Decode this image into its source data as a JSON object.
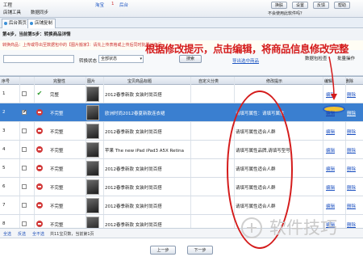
{
  "menubar": {
    "m1": "工程",
    "m2": "店铺工具",
    "m3": "数据同步",
    "title_a": "淘宝",
    "title_b": "1",
    "title_c": "后台",
    "btn1": "换肤",
    "btn2": "设置",
    "btn3": "反馈",
    "btn4": "帮助",
    "notice": "不会使用此软件吗？"
  },
  "tabs": [
    {
      "label": "后台首页"
    },
    {
      "label": "店铺复制"
    }
  ],
  "step": "第4步，当前第5步：转换商品详情",
  "links": {
    "l1": "转换商品：上传或导出至数据包中的【图片搬家】：请先上传表格或上传后同时批量对商品"
  },
  "filter": {
    "label": "转换状态",
    "select": "全部状态",
    "btn": "搜索",
    "right1": "导出选中商品",
    "right2": "数据包检查",
    "right3": "批量操作"
  },
  "annotation": "根据修改提示，点击编辑，将商品信息修改完整",
  "columns": {
    "num": "序号",
    "check": "",
    "state": "完整性",
    "img": "图片",
    "title": "宝贝商品标题",
    "cat": "自定义分类",
    "tip": "修改提示",
    "op1": "编辑",
    "op2": "删除"
  },
  "rows": [
    {
      "num": "1",
      "state": "完整",
      "title": "2012春季新款 女装时尚百搭",
      "tip": "",
      "edit": "编辑",
      "del": "删除",
      "ok": true,
      "checked": false
    },
    {
      "num": "2",
      "state": "不完整",
      "title": "欧洲时尚2012春夏新款连衣裙",
      "tip": "请填写属性：请填写属性",
      "edit": "编辑",
      "del": "删除",
      "ok": false,
      "checked": true
    },
    {
      "num": "3",
      "state": "不完整",
      "title": "2012春季新款 女装时尚百搭",
      "tip": "请填写属性适合人群",
      "edit": "编辑",
      "del": "删除",
      "ok": false,
      "checked": false
    },
    {
      "num": "4",
      "state": "不完整",
      "title": "苹果 The new iPad iPad3 A5X Retina",
      "tip": "请填写属性品牌,请填写型号",
      "edit": "编辑",
      "del": "删除",
      "ok": false,
      "checked": false
    },
    {
      "num": "5",
      "state": "不完整",
      "title": "2012春季新款 女装时尚百搭",
      "tip": "请填写属性适合人群",
      "edit": "编辑",
      "del": "删除",
      "ok": false,
      "checked": false
    },
    {
      "num": "6",
      "state": "不完整",
      "title": "2012春季新款 女装时尚百搭",
      "tip": "请填写属性适合人群",
      "edit": "编辑",
      "del": "删除",
      "ok": false,
      "checked": false
    },
    {
      "num": "7",
      "state": "不完整",
      "title": "2012春季新款 女装时尚百搭",
      "tip": "请填写属性适合人群",
      "edit": "编辑",
      "del": "删除",
      "ok": false,
      "checked": false
    },
    {
      "num": "8",
      "state": "不完整",
      "title": "2012春季新款 女装时尚百搭",
      "tip": "",
      "edit": "编辑",
      "del": "删除",
      "ok": false,
      "checked": false
    }
  ],
  "status": {
    "a": "全选",
    "b": "反选",
    "c": "全不选",
    "d": "共11宝贝数，当前第1页"
  },
  "footer": {
    "prev": "上一步",
    "next": "下一步"
  },
  "watermark": "软件技巧"
}
